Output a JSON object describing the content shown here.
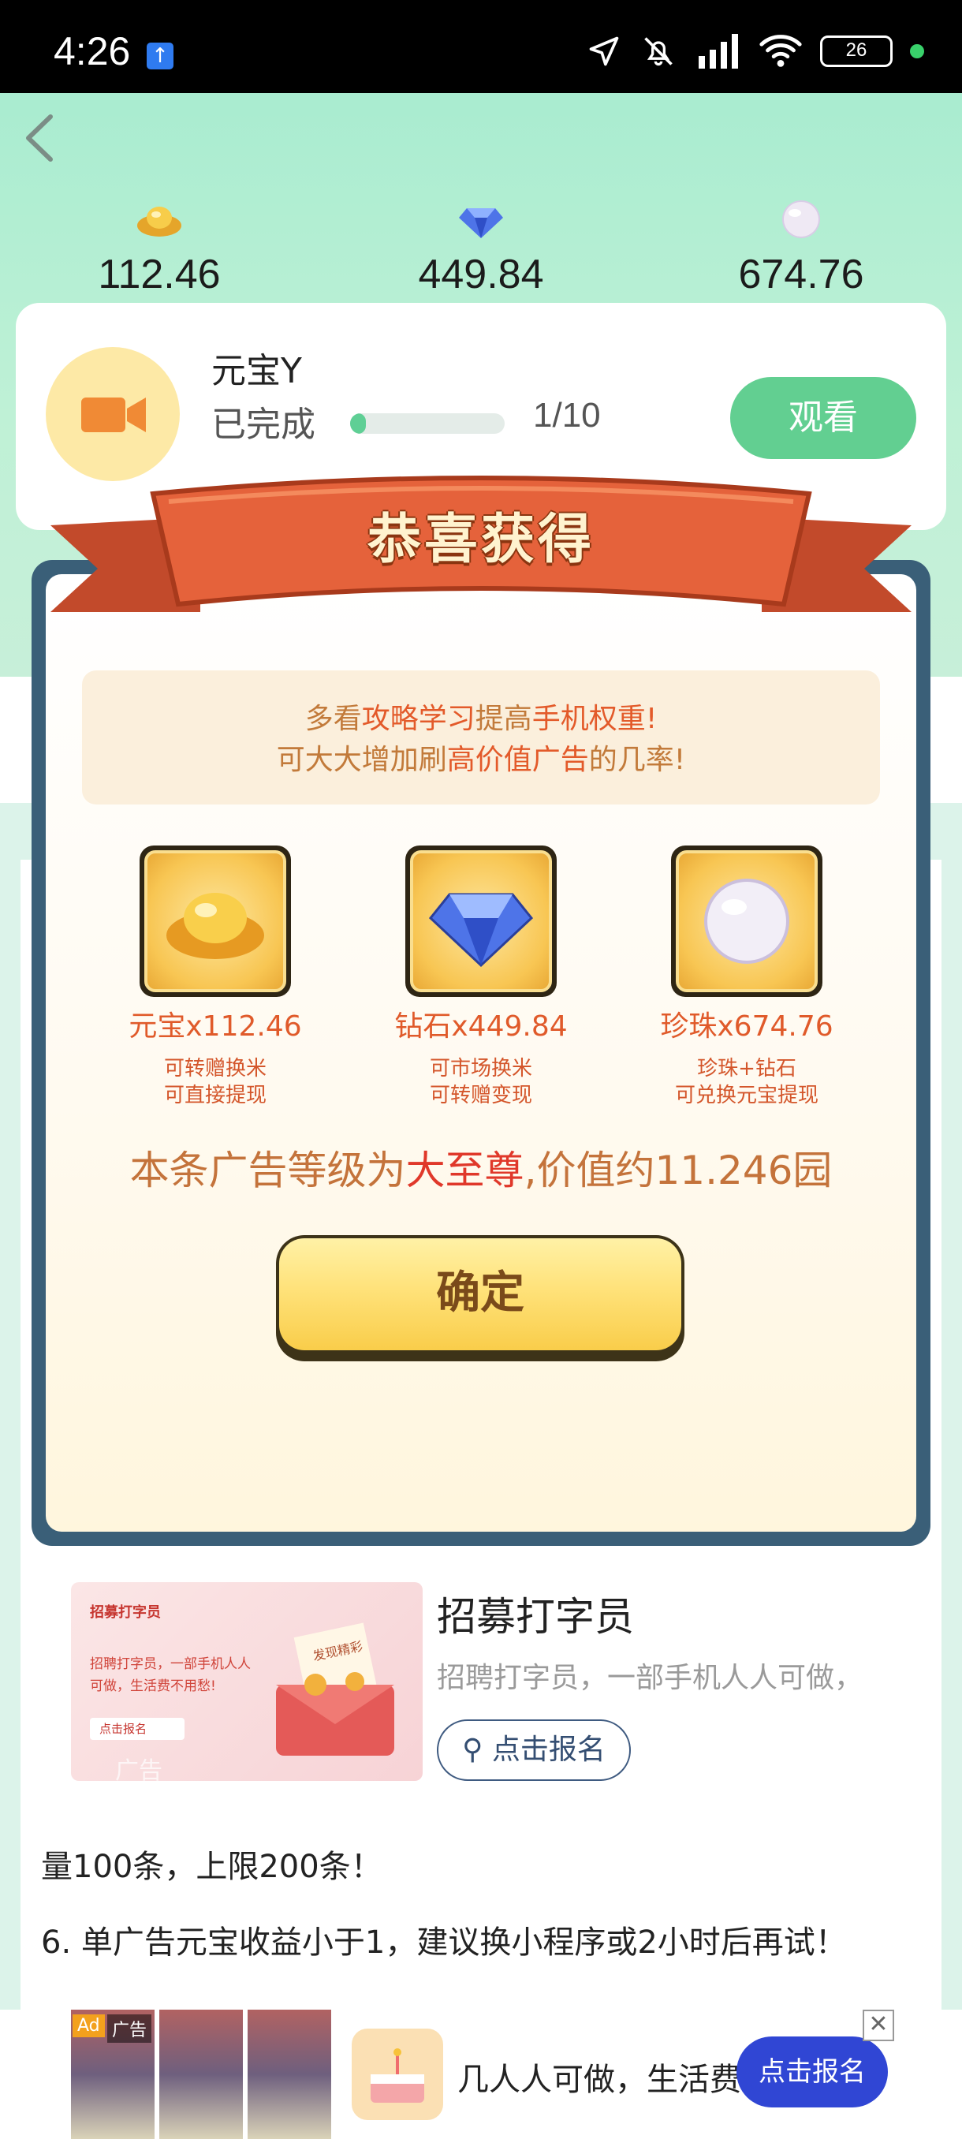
{
  "status_bar": {
    "time": "4:26",
    "battery": "26"
  },
  "stats": {
    "ingot": "112.46",
    "diamond": "449.84",
    "pearl": "674.76"
  },
  "task": {
    "title": "元宝Y",
    "status": "已完成",
    "progress_fraction": 0.1,
    "count": "1/10",
    "watch_button": "观看"
  },
  "modal": {
    "title": "恭喜获得",
    "tip": {
      "line1_a": "多看",
      "line1_b": "攻略学习",
      "line1_c": "提高",
      "line1_d": "手机权重",
      "line1_e": "!",
      "line2_a": "可大大增加刷",
      "line2_b": "高价值广告",
      "line2_c": "的几率!"
    },
    "rewards": [
      {
        "name": "元宝x112.46",
        "desc1": "可转赠换米",
        "desc2": "可直接提现",
        "icon": "gold-ingot-icon"
      },
      {
        "name": "钻石x449.84",
        "desc1": "可市场换米",
        "desc2": "可转赠变现",
        "icon": "diamond-icon"
      },
      {
        "name": "珍珠x674.76",
        "desc1": "珍珠+钻石",
        "desc2": "可兑换元宝提现",
        "icon": "pearl-icon"
      }
    ],
    "level": {
      "prefix": "本条广告等级为",
      "level": "大至尊",
      "suffix": ",价值约11.246园"
    },
    "confirm_button": "确定"
  },
  "page": {
    "ad_item": {
      "title": "招募打字员",
      "desc": "招聘打字员，一部手机人人可做，",
      "button": "点击报名",
      "thumb_badge": "招募打字员",
      "thumb_text": "招聘打字员，一部手机人人可做，生活费不用愁!",
      "thumb_btn": "点击报名",
      "thumb_env": "发现精彩",
      "thumb_ad": "广告"
    },
    "rule1": "量100条，上限200条！",
    "rule2": "6. 单广告元宝收益小于1，建议换小程序或2小时后再试！"
  },
  "banner": {
    "ad_tag": "Ad",
    "ad_label": "广告",
    "text": "几人人可做，生活费",
    "cta": "点击报名",
    "close": "✕"
  },
  "colors": {
    "accent_green": "#62cf91",
    "modal_border": "#3a5f78",
    "ribbon": "#e5623b",
    "cta_blue": "#3046d4"
  }
}
